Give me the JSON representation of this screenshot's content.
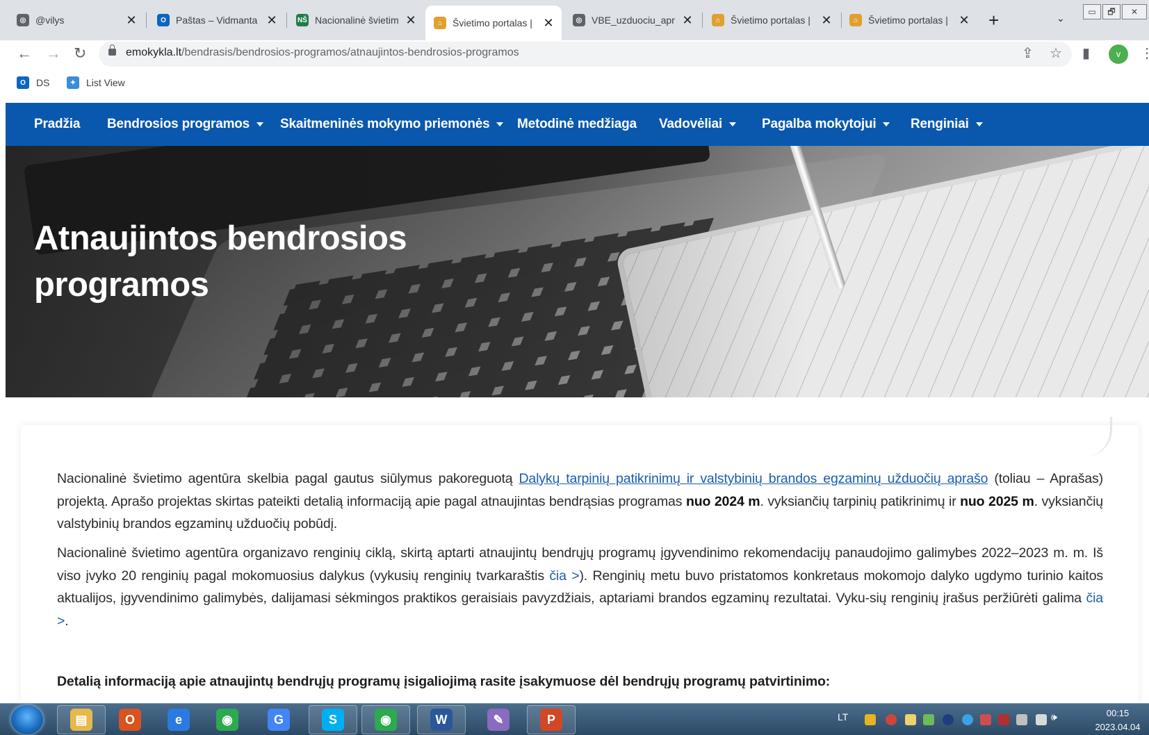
{
  "browser": {
    "tabs": [
      {
        "title": "@vilys",
        "icon": "globe-icon",
        "icon_color": "#5f6368"
      },
      {
        "title": "Paštas – Vidmanta",
        "icon": "outlook-icon",
        "icon_color": "#0a66c2"
      },
      {
        "title": "Nacionalinė švietim",
        "icon": "nsa-icon",
        "icon_color": "#1e7d4a"
      },
      {
        "title": "Švietimo portalas |",
        "icon": "portal-icon",
        "icon_color": "#e0a030",
        "active": true
      },
      {
        "title": "VBE_uzduociu_apr",
        "icon": "globe-icon",
        "icon_color": "#5f6368"
      },
      {
        "title": "Švietimo portalas |",
        "icon": "portal-icon",
        "icon_color": "#e0a030"
      },
      {
        "title": "Švietimo portalas |",
        "icon": "portal-icon",
        "icon_color": "#e0a030"
      }
    ],
    "close_glyph": "✕",
    "new_tab_glyph": "+",
    "tab_search_glyph": "⌄",
    "window_controls": [
      "▭",
      "🗗",
      "✕"
    ],
    "url_host": "emokykla.lt",
    "url_path": "/bendrasis/bendrosios-programos/atnaujintos-bendrosios-programos",
    "profile_initial": "v",
    "bookmarks": [
      {
        "label": "DS",
        "icon": "outlook-icon",
        "icon_color": "#0a66c2"
      },
      {
        "label": "List View",
        "icon": "sharepoint-icon",
        "icon_color": "#3a8ed8"
      }
    ]
  },
  "site": {
    "nav": [
      {
        "label": "Pradžia",
        "dropdown": false
      },
      {
        "label": "Bendrosios programos",
        "dropdown": true
      },
      {
        "label": "Skaitmeninės mokymo priemonės",
        "dropdown": true
      },
      {
        "label": "Metodinė medžiaga",
        "dropdown": false
      },
      {
        "label": "Vadovėliai",
        "dropdown": true
      },
      {
        "label": "Pagalba mokytojui",
        "dropdown": true
      },
      {
        "label": "Renginiai",
        "dropdown": true
      }
    ],
    "nav_color": "#0a58ad",
    "hero_title_line1": "Atnaujintos bendrosios",
    "hero_title_line2": "programos",
    "p1": {
      "t1": "Nacionalinė švietimo agentūra skelbia pagal gautus siūlymus pakoreguotą ",
      "link": "Dalykų tarpinių patikrinimų ir valstybinių brandos egzaminų užduočių aprašo",
      "t2": " (toliau – Aprašas) projektą. Aprašo projektas skirtas pateikti detalią informaciją apie pagal atnaujintas bendrąsias programas ",
      "b1": "nuo 2024 m",
      "t3": ". vyksiančių tarpinių patikrinimų ir ",
      "b2": "nuo 2025 m",
      "t4": ". vyksiančių valstybinių brandos egzaminų užduočių pobūdį."
    },
    "p2": {
      "t1": "Nacionalinė švietimo agentūra organizavo renginių ciklą, skirtą aptarti atnaujintų bendrųjų programų įgyvendinimo rekomendacijų panaudojimo galimybes 2022–2023 m. m. Iš viso įvyko 20 renginių pagal mokomuosius dalykus (vykusių renginių tvarkaraštis ",
      "link1": "čia >",
      "t2": "). Renginių metu buvo pristatomos konkretaus mokomojo dalyko ugdymo turinio kaitos aktualijos, įgyvendinimo galimybės, dalijamasi sėkmingos praktikos geraisiais pavyzdžiais, aptariami brandos egzaminų rezultatai. Vyku-sių renginių įrašus peržiūrėti galima ",
      "link2": "čia >",
      "t3": "."
    },
    "subheading": "Detalią informaciją apie atnaujintų bendrųjų programų įsigaliojimą rasite įsakymuose dėl bendrųjų programų patvirtinimo:"
  },
  "taskbar": {
    "apps": [
      {
        "name": "explorer",
        "icon": "folder-icon",
        "color": "#e7b84a",
        "glyph": "▤",
        "pinned_box": true
      },
      {
        "name": "outlook",
        "icon": "outlook-icon",
        "color": "#d9531e",
        "glyph": "O",
        "pinned_box": false
      },
      {
        "name": "internet-explorer",
        "icon": "ie-icon",
        "color": "#2a7ae2",
        "glyph": "e",
        "pinned_box": false
      },
      {
        "name": "chrome",
        "icon": "chrome-icon",
        "color": "#2da94f",
        "glyph": "◉",
        "pinned_box": false
      },
      {
        "name": "google",
        "icon": "google-icon",
        "color": "#4285f4",
        "glyph": "G",
        "pinned_box": false
      },
      {
        "name": "skype",
        "icon": "skype-icon",
        "color": "#00aff0",
        "glyph": "S",
        "pinned_box": true
      },
      {
        "name": "chrome-profile",
        "icon": "chrome-icon",
        "color": "#2da94f",
        "glyph": "◉",
        "pinned_box": true
      },
      {
        "name": "word",
        "icon": "word-icon",
        "color": "#2b579a",
        "glyph": "W",
        "pinned_box": true
      },
      {
        "name": "paint",
        "icon": "paint-icon",
        "color": "#8a6bbf",
        "glyph": "✎",
        "pinned_box": false
      },
      {
        "name": "powerpoint",
        "icon": "powerpoint-icon",
        "color": "#d24726",
        "glyph": "P",
        "pinned_box": true
      }
    ],
    "lang": "LT",
    "time": "00:15",
    "date": "2023.04.04"
  }
}
